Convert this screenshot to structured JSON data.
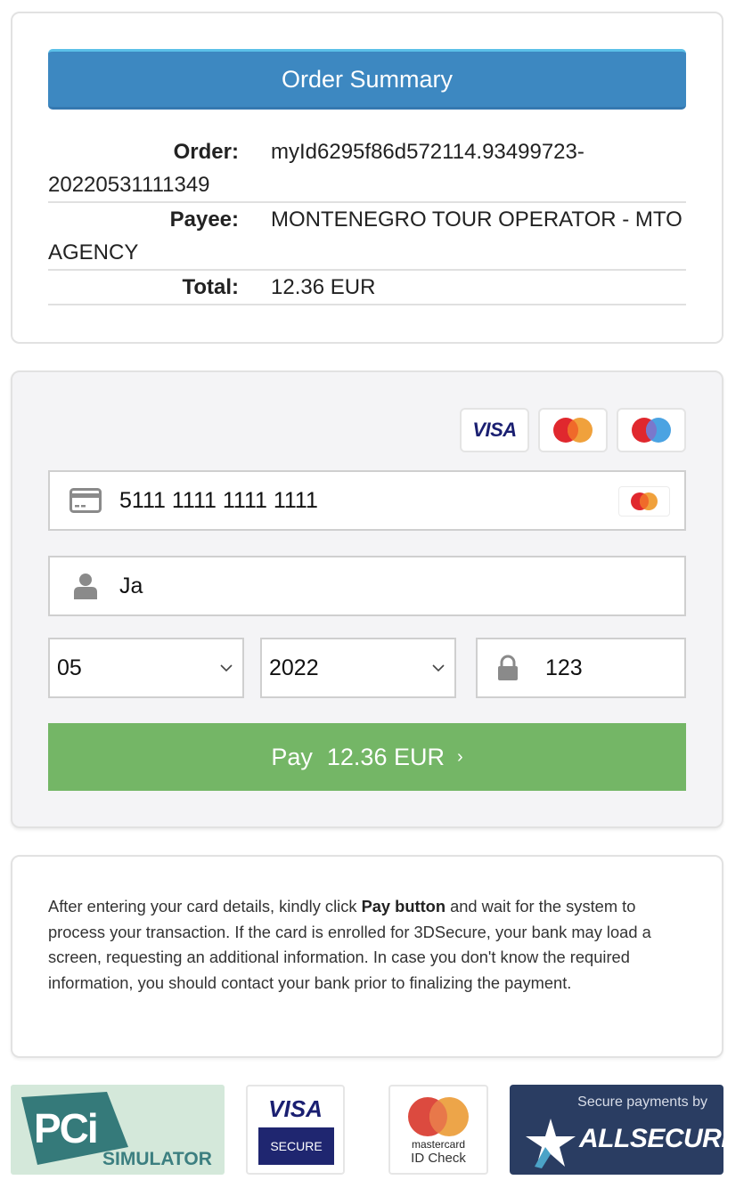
{
  "summary": {
    "title": "Order Summary",
    "rows": [
      {
        "label": "Order:",
        "value": "myId6295f86d572114.93499723-20220531111349"
      },
      {
        "label": "Payee:",
        "value": "MONTENEGRO TOUR OPERATOR - MTO AGENCY"
      },
      {
        "label": "Total:",
        "value": "12.36 EUR"
      }
    ]
  },
  "payment_form": {
    "accepted_brands": [
      "visa",
      "mastercard",
      "maestro"
    ],
    "visa_label": "VISA",
    "card_number": {
      "icon": "credit-card-icon",
      "value": "5111 1111 1111 1111",
      "detected_brand": "mastercard"
    },
    "cardholder": {
      "icon": "user-icon",
      "value": "Ja"
    },
    "expiry_month": {
      "value": "05"
    },
    "expiry_year": {
      "value": "2022"
    },
    "cvv": {
      "icon": "lock-icon",
      "value": "123"
    },
    "pay_button": {
      "label": "Pay",
      "amount": "12.36 EUR",
      "arrow": "›"
    }
  },
  "info": {
    "text_before": "After entering your card details, kindly click ",
    "bold": "Pay button",
    "text_after": " and wait for the system to process your transaction. If the card is enrolled for 3DSecure, your bank may load a screen, requesting an additional information. In case you don't know the required information, you should contact your bank prior to finalizing the payment."
  },
  "badges": {
    "pci": {
      "logo": "PCi",
      "caption": "SIMULATOR"
    },
    "visa_secure": {
      "brand": "VISA",
      "caption": "SECURE"
    },
    "mastercard_id_check": {
      "brand": "mastercard",
      "caption": "ID Check"
    },
    "allsecure": {
      "tagline": "Secure payments by",
      "brand": "ALLSECURE"
    }
  },
  "colors": {
    "header_blue": "#3d88c1",
    "pay_green": "#74b666",
    "visa_navy": "#1a1f71",
    "mc_red": "#e0282e",
    "mc_orange": "#f0a13c",
    "maestro_blue": "#4ba3e2",
    "allsecure_navy": "#2a3d62"
  }
}
